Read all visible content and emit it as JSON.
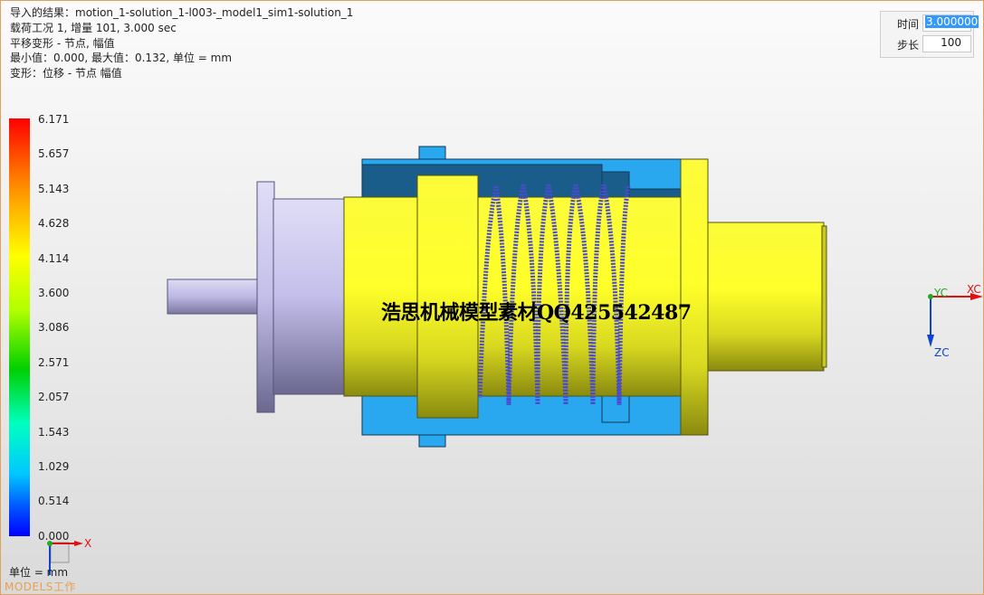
{
  "info": {
    "line1": "导入的结果：motion_1-solution_1-l003-_model1_sim1-solution_1",
    "line2": "载荷工况 1, 增量 101, 3.000 sec",
    "line3": "平移变形 - 节点, 幅值",
    "line4": "最小值：0.000, 最大值：0.132, 单位 = mm",
    "line5": "变形：位移 - 节点 幅值"
  },
  "time_panel": {
    "time_label": "时间",
    "time_value": "3.000000",
    "step_label": "步长",
    "step_value": "100"
  },
  "legend": {
    "values": [
      "6.171",
      "5.657",
      "5.143",
      "4.628",
      "4.114",
      "3.600",
      "3.086",
      "2.571",
      "2.057",
      "1.543",
      "1.029",
      "0.514",
      "0.000"
    ],
    "unit": "单位 = mm"
  },
  "watermark": "浩思机械模型素材QQ425542487",
  "axes": {
    "xc": "XC",
    "yc": "YC",
    "zc": "ZC",
    "small_x": "X"
  },
  "status_text": "MODELS工作",
  "colors": {
    "yellow": "#ffff2a",
    "blue": "#29a8ef",
    "dark_blue": "#1a5d8a",
    "purple": "#c8c3ec",
    "spring": "#4a4acc",
    "frame": "#e0a060"
  }
}
